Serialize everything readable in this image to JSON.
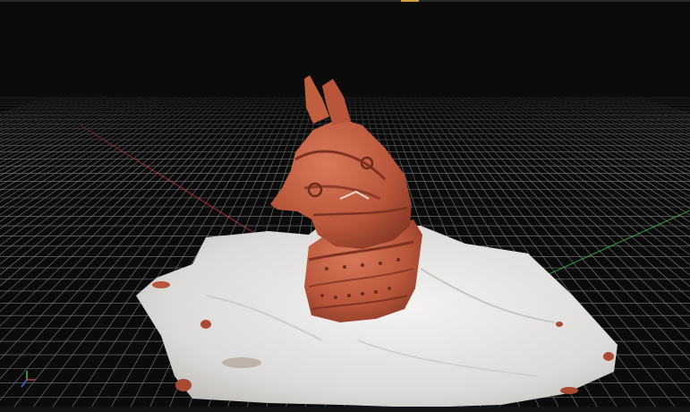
{
  "app": {
    "view": "3D viewport"
  },
  "scene": {
    "background": "#0b0b0c",
    "grid_color": "#d8d8d8",
    "x_axis_color": "#c8343a",
    "y_axis_color": "#3fbf4a",
    "model_color": "#b8553a",
    "cloth_color": "#e8e6e4"
  },
  "gizmo": {
    "icon": "axis-gizmo-icon"
  },
  "accent": "#d8a23a"
}
